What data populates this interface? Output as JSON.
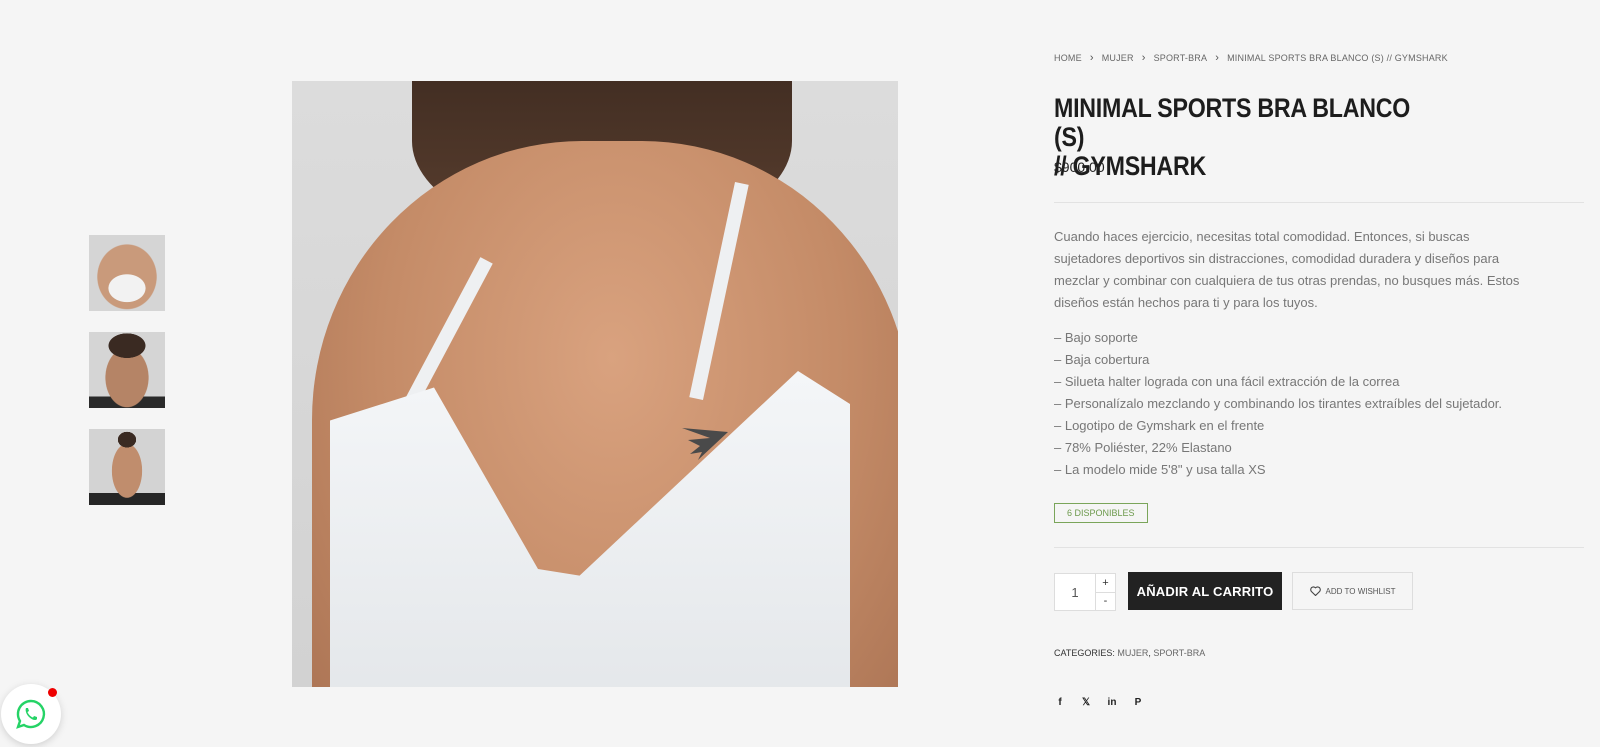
{
  "breadcrumb": [
    "HOME",
    "MUJER",
    "SPORT-BRA",
    "MINIMAL SPORTS BRA BLANCO (S) // GYMSHARK"
  ],
  "product": {
    "title": "MINIMAL SPORTS BRA BLANCO (S)\n// GYMSHARK",
    "price": "$900,00",
    "description": "Cuando haces ejercicio, necesitas total comodidad. Entonces, si buscas sujetadores deportivos sin distracciones, comodidad duradera y diseños para mezclar y combinar con cualquiera de tus otras prendas, no busques más. Estos diseños están hechos para ti y para los tuyos.",
    "features": [
      "– Bajo soporte",
      "– Baja cobertura",
      "– Silueta halter lograda con una fácil extracción de la correa",
      "– Personalízalo mezclando y combinando los tirantes extraíbles del sujetador.",
      "– Logotipo de Gymshark en el frente",
      "– 78% Poliéster, 22% Elastano",
      "– La modelo mide 5'8\" y usa talla XS"
    ],
    "stock": "6 DISPONIBLES"
  },
  "cart": {
    "quantity": "1",
    "plus": "+",
    "minus": "-",
    "add_label": "AÑADIR AL CARRITO",
    "wishlist_label": "ADD TO WISHLIST"
  },
  "categories": {
    "label": "CATEGORIES:",
    "items": [
      "MUJER",
      "SPORT-BRA"
    ]
  },
  "share": {
    "facebook": "f",
    "x": "𝕏",
    "linkedin": "in",
    "pinterest": "P"
  },
  "gallery": {
    "thumbnails": [
      "front-view",
      "back-view",
      "full-view"
    ]
  },
  "colors": {
    "background": "#f5f5f5",
    "button": "#222222",
    "stock_green": "#6d9a4d",
    "whatsapp": "#25d366"
  }
}
